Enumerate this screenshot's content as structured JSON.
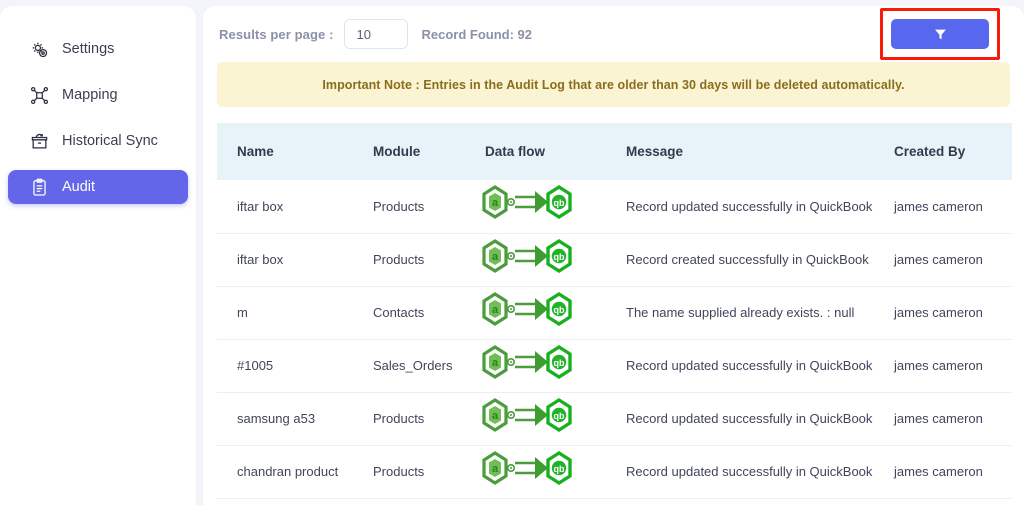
{
  "sidebar": {
    "items": [
      {
        "label": "Settings",
        "icon": "gear-icon",
        "active": false
      },
      {
        "label": "Mapping",
        "icon": "network-icon",
        "active": false
      },
      {
        "label": "Historical Sync",
        "icon": "archive-sync-icon",
        "active": false
      },
      {
        "label": "Audit",
        "icon": "clipboard-icon",
        "active": true
      }
    ],
    "active_color": "#6366e8"
  },
  "toolbar": {
    "results_per_page_label": "Results per page :",
    "results_per_page_value": "10",
    "results_per_page_placeholder": "10",
    "record_found": "Record Found: 92",
    "filter_button_label": "",
    "filter_icon": "funnel-icon",
    "filter_highlight_color": "#f81b09",
    "filter_button_color": "#5868ee"
  },
  "note": {
    "text": "Important Note : Entries in the Audit Log that are older than 30 days will be deleted automatically.",
    "background": "#fbf4d2",
    "text_color": "#8a6d1e"
  },
  "table": {
    "headers": [
      "Name",
      "Module",
      "Data flow",
      "Message",
      "Created By"
    ],
    "header_background": "#e8f2f9",
    "rows": [
      {
        "name": "iftar box",
        "module": "Products",
        "flow": {
          "source": "amazon-icon",
          "target": "quickbooks-icon",
          "direction": "right-arrow"
        },
        "message": "Record updated successfully in QuickBook",
        "created_by": "james cameron"
      },
      {
        "name": "iftar box",
        "module": "Products",
        "flow": {
          "source": "amazon-icon",
          "target": "quickbooks-icon",
          "direction": "right-arrow"
        },
        "message": "Record created successfully in QuickBook",
        "created_by": "james cameron"
      },
      {
        "name": "m",
        "module": "Contacts",
        "flow": {
          "source": "amazon-icon",
          "target": "quickbooks-icon",
          "direction": "right-arrow"
        },
        "message": "The name supplied already exists. : null",
        "created_by": "james cameron"
      },
      {
        "name": "#1005",
        "module": "Sales_Orders",
        "flow": {
          "source": "amazon-icon",
          "target": "quickbooks-icon",
          "direction": "right-arrow"
        },
        "message": "Record updated successfully in QuickBook",
        "created_by": "james cameron"
      },
      {
        "name": "samsung a53",
        "module": "Products",
        "flow": {
          "source": "amazon-icon",
          "target": "quickbooks-icon",
          "direction": "right-arrow"
        },
        "message": "Record updated successfully in QuickBook",
        "created_by": "james cameron"
      },
      {
        "name": "chandran product",
        "module": "Products",
        "flow": {
          "source": "amazon-icon",
          "target": "quickbooks-icon",
          "direction": "right-arrow"
        },
        "message": "Record updated successfully in QuickBook",
        "created_by": "james cameron"
      }
    ]
  }
}
